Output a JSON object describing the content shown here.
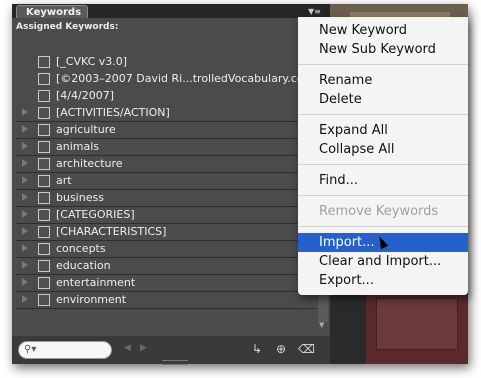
{
  "panel": {
    "tab_label": "Keywords",
    "assigned_label": "Assigned Keywords:"
  },
  "keywords": [
    {
      "label": "[_CVKC v3.0]",
      "expandable": false
    },
    {
      "label": "[©2003–2007 David Ri...trolledVocabulary.co",
      "expandable": false
    },
    {
      "label": "[4/4/2007]",
      "expandable": false
    },
    {
      "label": "[ACTIVITIES/ACTION]",
      "expandable": true
    },
    {
      "label": "agriculture",
      "expandable": true
    },
    {
      "label": "animals",
      "expandable": true
    },
    {
      "label": "architecture",
      "expandable": true
    },
    {
      "label": "art",
      "expandable": true
    },
    {
      "label": "business",
      "expandable": true
    },
    {
      "label": "[CATEGORIES]",
      "expandable": true
    },
    {
      "label": "[CHARACTERISTICS]",
      "expandable": true
    },
    {
      "label": "concepts",
      "expandable": true
    },
    {
      "label": "education",
      "expandable": true
    },
    {
      "label": "entertainment",
      "expandable": true
    },
    {
      "label": "environment",
      "expandable": true
    }
  ],
  "menu": {
    "new_keyword": "New Keyword",
    "new_sub_keyword": "New Sub Keyword",
    "rename": "Rename",
    "delete": "Delete",
    "expand_all": "Expand All",
    "collapse_all": "Collapse All",
    "find": "Find...",
    "remove_keywords": "Remove Keywords",
    "import": "Import...",
    "clear_and_import": "Clear and Import...",
    "export": "Export..."
  },
  "colors": {
    "selection": "#2361cc",
    "panel_bg": "#4b4b4b",
    "menu_bg": "#f4f4f4"
  }
}
